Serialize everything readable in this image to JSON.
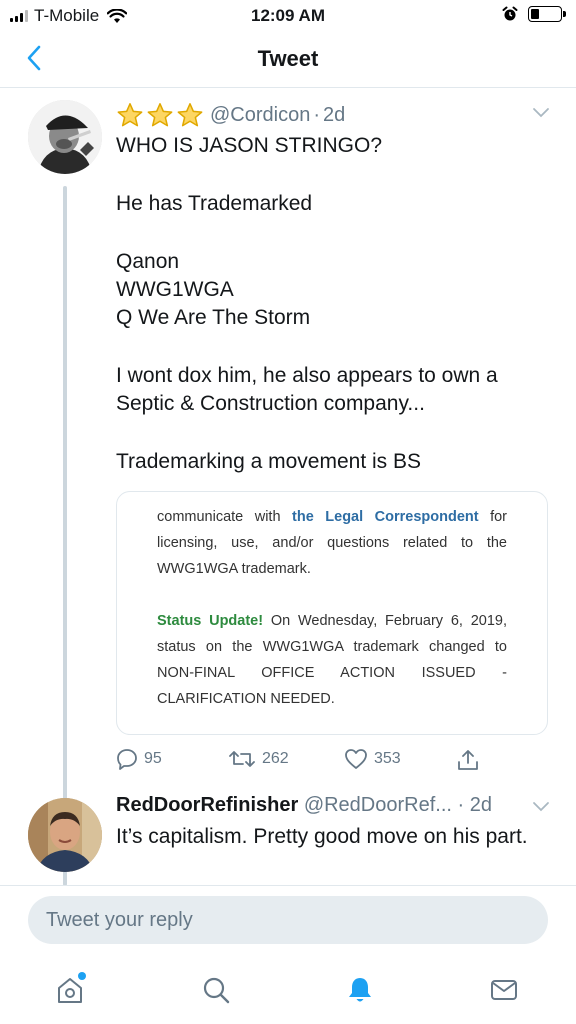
{
  "status_bar": {
    "carrier": "T-Mobile",
    "time": "12:09 AM",
    "battery_level": 0.3
  },
  "nav": {
    "title": "Tweet",
    "back_icon": "chevron-left-icon"
  },
  "tweet": {
    "handle": "@Cordicon",
    "separator": "·",
    "age": "2d",
    "badge_icons": [
      "star-icon",
      "star-icon",
      "star-icon"
    ],
    "lines": {
      "line1": "WHO IS JASON STRINGO?",
      "line2": "He has Trademarked",
      "line3": "Qanon",
      "line4": "WWG1WGA",
      "line5": "Q We Are The Storm",
      "line6": "I wont dox him, he also appears to own a Septic & Construction company...",
      "line7": "Trademarking a movement is BS"
    },
    "media": {
      "p1_pre": "communicate with",
      "p1_link": "the Legal Correspondent",
      "p1_post": "for licensing, use, and/or questions related to the WWG1WGA trademark.",
      "p2_label": "Status Update!",
      "p2_text": "On Wednesday, February 6, 2019, status on the WWG1WGA trademark changed to NON-FINAL OFFICE ACTION ISSUED - CLARIFICATION NEEDED."
    },
    "actions": {
      "replies": "95",
      "retweets": "262",
      "likes": "353"
    },
    "colors": {
      "link_blue": "#2e6da4",
      "status_green": "#2e8b3f",
      "star_gold": "#f5c518"
    }
  },
  "reply": {
    "name": "RedDoorRefinisher",
    "handle": "@RedDoorRef...",
    "separator": "·",
    "age": "2d",
    "text": "It’s capitalism. Pretty good move on his part."
  },
  "compose": {
    "placeholder": "Tweet your reply"
  },
  "tabbar": {
    "items": [
      "home-icon",
      "search-icon",
      "notifications-icon",
      "messages-icon"
    ],
    "accent": "#1da1f2"
  }
}
